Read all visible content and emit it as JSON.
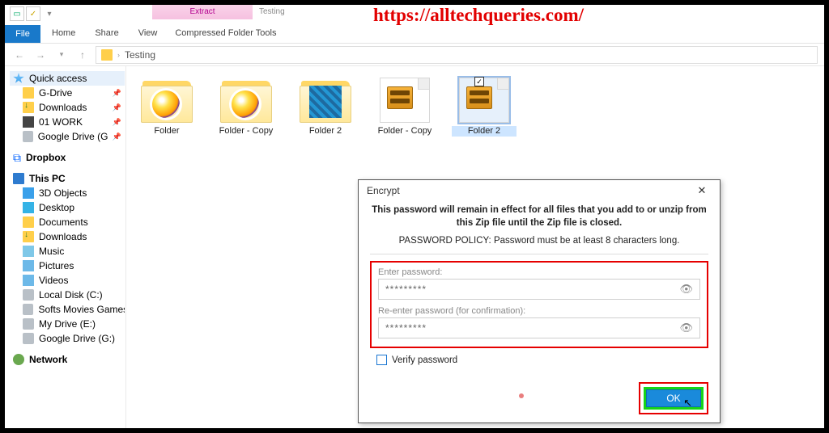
{
  "watermark": "https://alltechqueries.com/",
  "ribbon": {
    "context_tab": "Extract",
    "context_group": "Testing",
    "file": "File",
    "home": "Home",
    "share": "Share",
    "view": "View",
    "tools_label": "Compressed Folder Tools"
  },
  "address": {
    "root": "Testing"
  },
  "quick_access": {
    "header": "Quick access",
    "items": [
      "G-Drive",
      "Downloads",
      "01 WORK",
      "Google Drive (G:)"
    ]
  },
  "dropbox": "Dropbox",
  "this_pc": {
    "header": "This PC",
    "items": [
      "3D Objects",
      "Desktop",
      "Documents",
      "Downloads",
      "Music",
      "Pictures",
      "Videos",
      "Local Disk (C:)",
      "Softs Movies Games",
      "My Drive (E:)",
      "Google Drive (G:)"
    ]
  },
  "network": "Network",
  "tiles": [
    {
      "label": "Folder",
      "type": "round"
    },
    {
      "label": "Folder - Copy",
      "type": "round"
    },
    {
      "label": "Folder 2",
      "type": "rect"
    },
    {
      "label": "Folder - Copy",
      "type": "zip"
    },
    {
      "label": "Folder 2",
      "type": "zip",
      "selected": true
    }
  ],
  "dialog": {
    "title": "Encrypt",
    "bold_line": "This password will remain in effect for all files that you add to or unzip from this Zip file until the Zip file is closed.",
    "policy": "PASSWORD POLICY: Password must be at least 8 characters long.",
    "enter_label": "Enter password:",
    "reenter_label": "Re-enter password (for confirmation):",
    "pw_mask1": "*********",
    "pw_mask2": "*********",
    "verify": "Verify password",
    "ok": "OK"
  }
}
